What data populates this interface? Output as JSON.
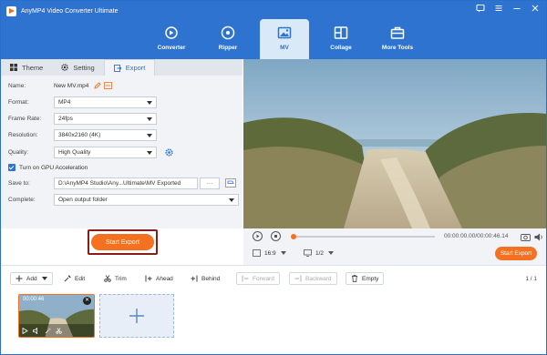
{
  "app": {
    "title": "AnyMP4 Video Converter Ultimate"
  },
  "window_controls": [
    "chat-icon",
    "menu-icon",
    "minimize-icon",
    "close-icon"
  ],
  "nav": {
    "tabs": [
      {
        "label": "Converter",
        "icon": "converter-icon",
        "active": false
      },
      {
        "label": "Ripper",
        "icon": "ripper-icon",
        "active": false
      },
      {
        "label": "MV",
        "icon": "mv-icon",
        "active": true
      },
      {
        "label": "Collage",
        "icon": "collage-icon",
        "active": false
      },
      {
        "label": "More Tools",
        "icon": "toolbox-icon",
        "active": false
      }
    ]
  },
  "subtabs": [
    {
      "label": "Theme",
      "active": false
    },
    {
      "label": "Setting",
      "active": false
    },
    {
      "label": "Export",
      "active": true
    }
  ],
  "export": {
    "name_label": "Name:",
    "name_value": "New MV.mp4",
    "format_label": "Format:",
    "format_value": "MP4",
    "framerate_label": "Frame Rate:",
    "framerate_value": "24fps",
    "resolution_label": "Resolution:",
    "resolution_value": "3840x2160 (4K)",
    "quality_label": "Quality:",
    "quality_value": "High Quality",
    "gpu_label": "Turn on GPU Acceleration",
    "gpu_checked": true,
    "saveto_label": "Save to:",
    "saveto_value": "D:\\AnyMP4 Studio\\Any...Ultimate\\MV Exported",
    "browse_label": "···",
    "complete_label": "Complete:",
    "complete_value": "Open output folder",
    "start_label": "Start Export"
  },
  "player": {
    "time": "00:00:00.00/00:00:46.14",
    "aspect": "16:9",
    "page": "1/2",
    "export_label": "Start Export"
  },
  "toolbar": {
    "add": "Add",
    "edit": "Edit",
    "trim": "Trim",
    "ahead": "Ahead",
    "behind": "Behind",
    "forward": "Forward",
    "backward": "Backward",
    "empty": "Empty",
    "page_count": "1 / 1"
  },
  "clip": {
    "duration": "00:00:46"
  },
  "colors": {
    "brand": "#2d73cf",
    "accent": "#f47121",
    "highlight_border": "#8b1a1a"
  }
}
